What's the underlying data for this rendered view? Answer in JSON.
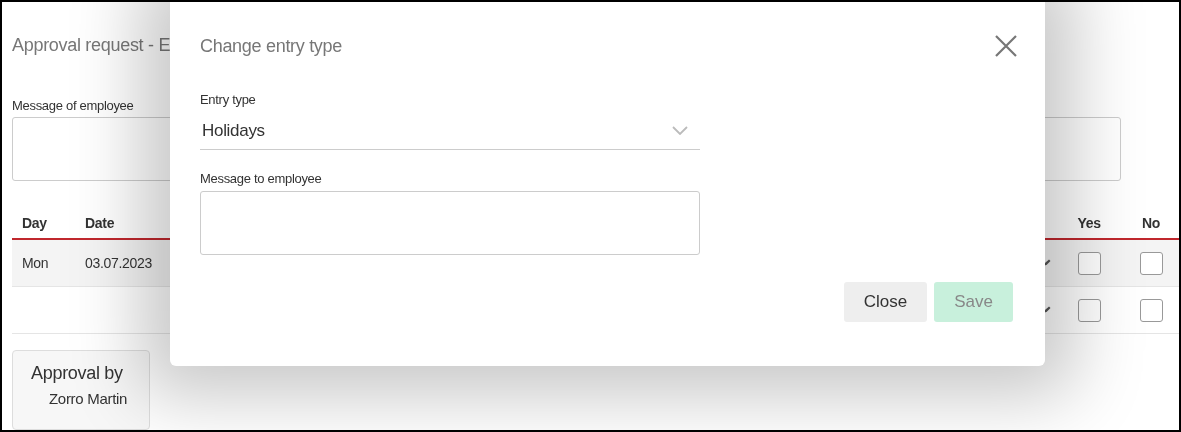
{
  "page": {
    "title": "Approval request - E",
    "message_label": "Message of employee",
    "table": {
      "columns": [
        "Day",
        "Date",
        "Yes",
        "No"
      ],
      "rows": [
        {
          "day": "Mon",
          "date": "03.07.2023",
          "checks": [
            {
              "checked": false
            },
            {
              "checked": false
            }
          ]
        },
        {
          "checks": [
            {
              "checked": false
            },
            {
              "checked": false
            }
          ]
        }
      ]
    },
    "approval": {
      "title": "Approval by",
      "name": "Zorro Martin"
    }
  },
  "dialog": {
    "title": "Change entry type",
    "entry_type": {
      "label": "Entry type",
      "value": "Holidays"
    },
    "message": {
      "label": "Message to employee"
    },
    "buttons": [
      {
        "label": "Close",
        "disabled": false
      },
      {
        "label": "Save",
        "disabled": true
      }
    ]
  }
}
